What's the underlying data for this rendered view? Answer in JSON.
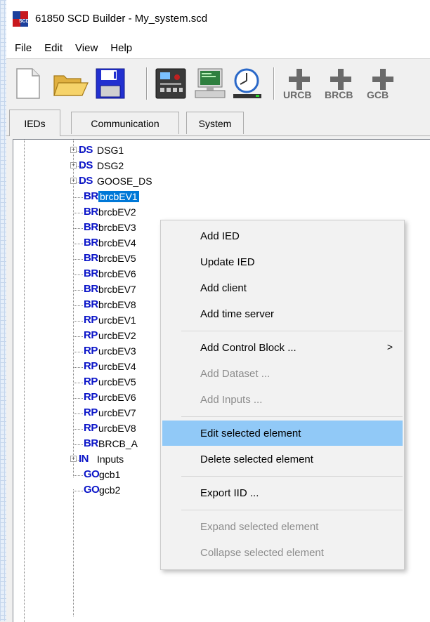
{
  "window": {
    "title": "61850 SCD Builder - My_system.scd",
    "icon_label": "SCD"
  },
  "menubar": {
    "items": [
      "File",
      "Edit",
      "View",
      "Help"
    ]
  },
  "toolbar": {
    "icons": [
      "new-file-icon",
      "open-folder-icon",
      "save-icon",
      "ied-device-icon",
      "computer-client-icon",
      "time-server-clock-icon",
      "add-urcb-icon",
      "add-brcb-icon",
      "add-gcb-icon"
    ],
    "urcb_label": "URCB",
    "brcb_label": "BRCB",
    "gcb_label": "GCB"
  },
  "tabs": [
    "IEDs",
    "Communication",
    "System"
  ],
  "tree": {
    "rows": [
      {
        "tag": "DS",
        "label": "DSG1",
        "expandable": true,
        "tag_color": "#0a14c8"
      },
      {
        "tag": "DS",
        "label": "DSG2",
        "expandable": true,
        "tag_color": "#0a14c8"
      },
      {
        "tag": "DS",
        "label": "GOOSE_DS",
        "expandable": true,
        "tag_color": "#0a14c8"
      },
      {
        "tag": "BR",
        "label": "brcbEV1",
        "selected": true
      },
      {
        "tag": "BR",
        "label": "brcbEV2"
      },
      {
        "tag": "BR",
        "label": "brcbEV3"
      },
      {
        "tag": "BR",
        "label": "brcbEV4"
      },
      {
        "tag": "BR",
        "label": "brcbEV5"
      },
      {
        "tag": "BR",
        "label": "brcbEV6"
      },
      {
        "tag": "BR",
        "label": "brcbEV7"
      },
      {
        "tag": "BR",
        "label": "brcbEV8"
      },
      {
        "tag": "RP",
        "label": "urcbEV1"
      },
      {
        "tag": "RP",
        "label": "urcbEV2"
      },
      {
        "tag": "RP",
        "label": "urcbEV3"
      },
      {
        "tag": "RP",
        "label": "urcbEV4"
      },
      {
        "tag": "RP",
        "label": "urcbEV5"
      },
      {
        "tag": "RP",
        "label": "urcbEV6"
      },
      {
        "tag": "RP",
        "label": "urcbEV7"
      },
      {
        "tag": "RP",
        "label": "urcbEV8"
      },
      {
        "tag": "BR",
        "label": "BRCB_A"
      },
      {
        "tag": "IN",
        "label": "Inputs",
        "expandable": true
      },
      {
        "tag": "GO",
        "label": "gcb1"
      },
      {
        "tag": "GO",
        "label": "gcb2"
      }
    ]
  },
  "context_menu": {
    "items": [
      {
        "label": "Add IED",
        "enabled": true
      },
      {
        "label": "Update IED",
        "enabled": true
      },
      {
        "label": "Add client",
        "enabled": true
      },
      {
        "label": "Add time server",
        "enabled": true
      },
      {
        "separator": true
      },
      {
        "label": "Add Control Block ...",
        "enabled": true,
        "submenu": true
      },
      {
        "label": "Add Dataset ...",
        "enabled": false
      },
      {
        "label": "Add Inputs ...",
        "enabled": false
      },
      {
        "separator": true
      },
      {
        "label": "Edit selected element",
        "enabled": true,
        "highlighted": true
      },
      {
        "label": "Delete selected element",
        "enabled": true
      },
      {
        "separator": true
      },
      {
        "label": "Export IID ...",
        "enabled": true
      },
      {
        "separator": true
      },
      {
        "label": "Expand selected element",
        "enabled": false
      },
      {
        "label": "Collapse selected element",
        "enabled": false
      }
    ],
    "submenu_arrow": ">"
  },
  "colors": {
    "tag_blue": "#0a14c8",
    "selection": "#0078d7",
    "menu_highlight": "#91c9f7"
  }
}
